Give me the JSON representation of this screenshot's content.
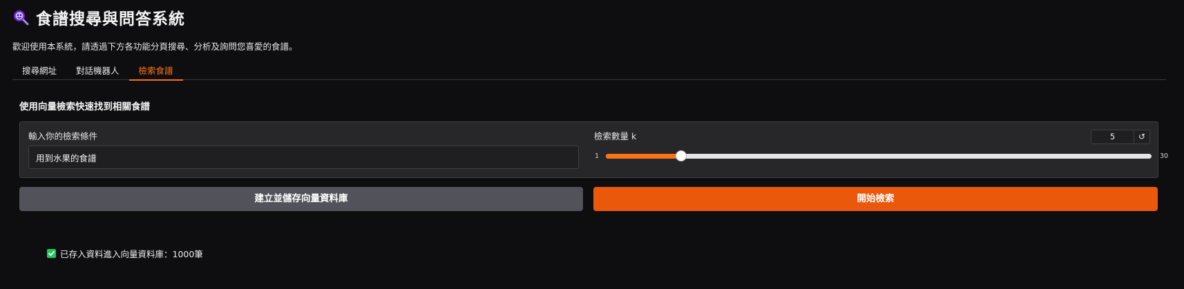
{
  "header": {
    "title": "食譜搜尋與問答系統",
    "icon": "magnifier-chat-icon"
  },
  "intro": "歡迎使用本系統，請透過下方各功能分頁搜尋、分析及詢問您喜愛的食譜。",
  "tabs": [
    {
      "label": "搜尋網址",
      "active": false
    },
    {
      "label": "對話機器人",
      "active": false
    },
    {
      "label": "檢索食譜",
      "active": true
    }
  ],
  "section_title": "使用向量檢索快速找到相關食譜",
  "query": {
    "label": "輸入你的檢索條件",
    "value": "用到水果的食譜"
  },
  "k_slider": {
    "label": "檢索數量 k",
    "value": 5,
    "min": 1,
    "max": 30,
    "reset_icon": "reset-icon"
  },
  "buttons": {
    "build": "建立並儲存向量資料庫",
    "search": "開始檢索"
  },
  "status": {
    "icon": "check-icon",
    "text": "已存入資料進入向量資料庫：1000筆"
  },
  "colors": {
    "accent": "#f97316",
    "primary_button": "#ea580c",
    "secondary_button": "#52525b",
    "background": "#0e0e10",
    "success": "#22c55e"
  }
}
